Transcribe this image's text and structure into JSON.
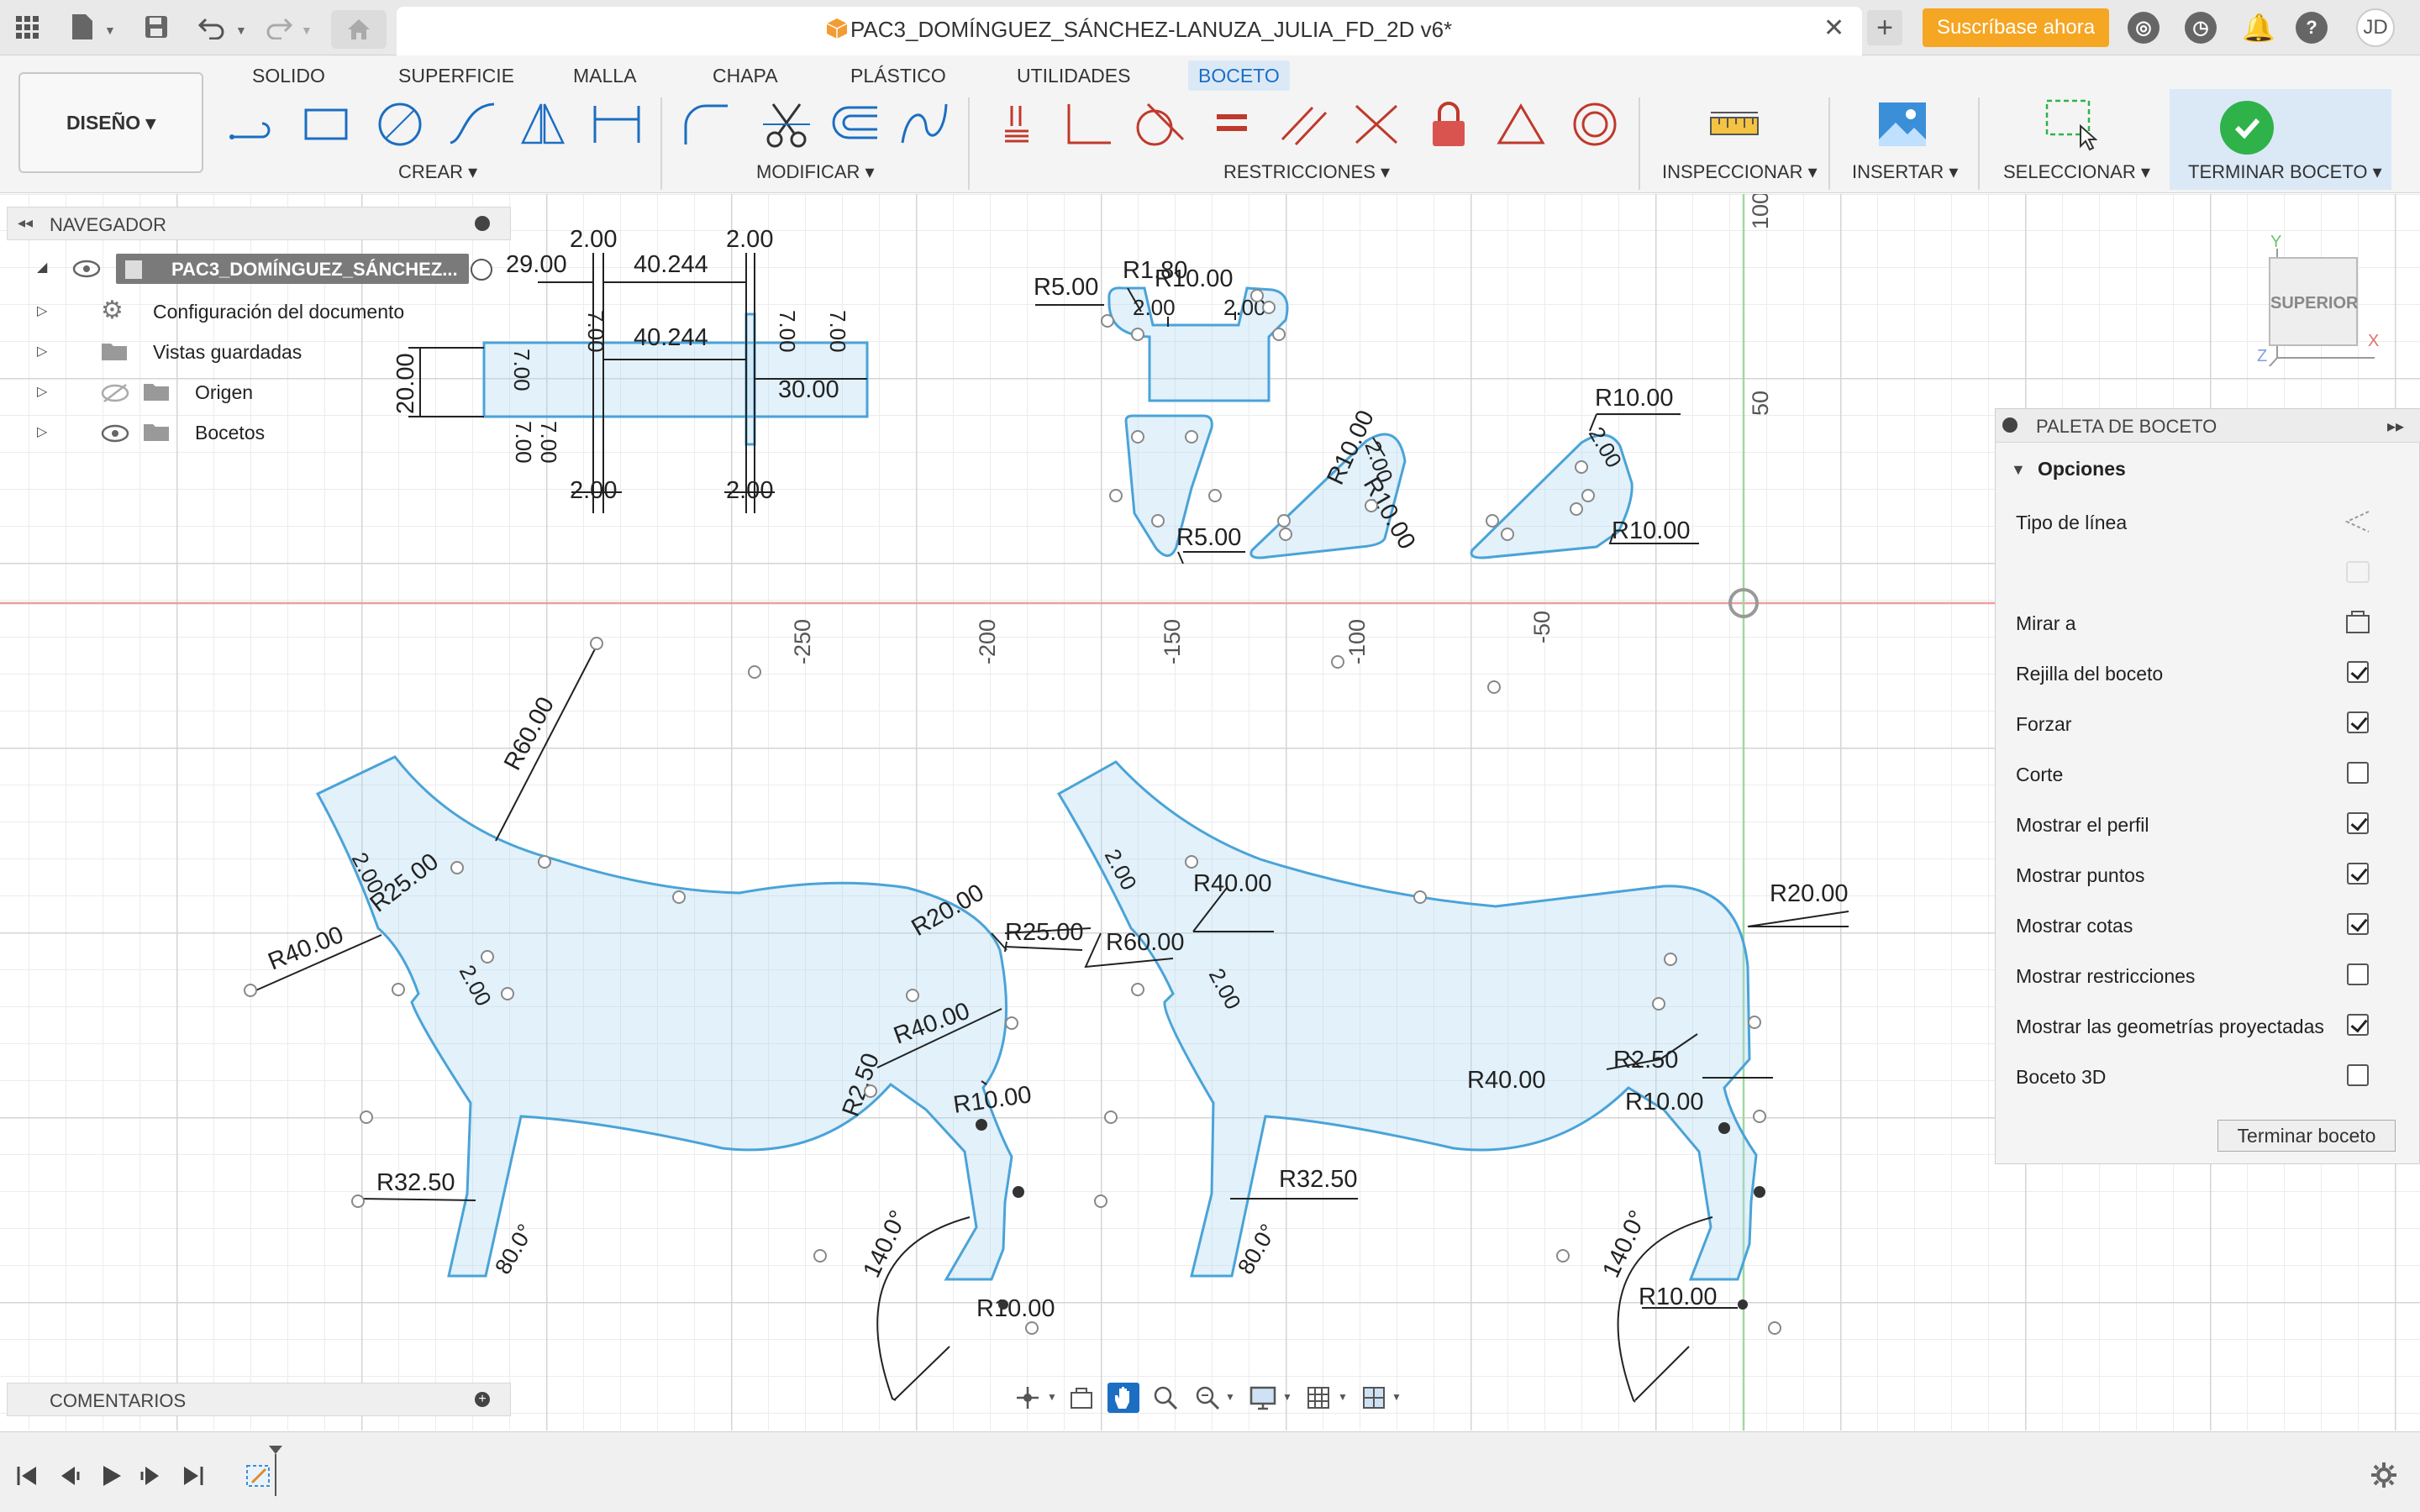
{
  "window": {
    "document_title": "PAC3_DOMÍNGUEZ_SÁNCHEZ-LANUZA_JULIA_FD_2D v6*",
    "subscribe_label": "Suscríbase ahora",
    "user_initials": "JD"
  },
  "ribbon": {
    "tabs": [
      "SOLIDO",
      "SUPERFICIE",
      "MALLA",
      "CHAPA",
      "PLÁSTICO",
      "UTILIDADES",
      "BOCETO"
    ],
    "active_tab": "BOCETO",
    "workspace_label": "DISEÑO ▾",
    "groups": {
      "crear": "CREAR ▾",
      "modificar": "MODIFICAR ▾",
      "restricciones": "RESTRICCIONES ▾",
      "inspeccionar": "INSPECCIONAR ▾",
      "insertar": "INSERTAR ▾",
      "seleccionar": "SELECCIONAR ▾",
      "terminar": "TERMINAR BOCETO ▾"
    }
  },
  "navigator": {
    "title": "NAVEGADOR",
    "root": "PAC3_DOMÍNGUEZ_SÁNCHEZ...",
    "items": [
      {
        "label": "Configuración del documento",
        "icon": "gear-icon"
      },
      {
        "label": "Vistas guardadas",
        "icon": "folder-icon"
      },
      {
        "label": "Origen",
        "icon": "folder-icon"
      },
      {
        "label": "Bocetos",
        "icon": "folder-icon"
      }
    ]
  },
  "palette": {
    "title": "PALETA DE BOCETO",
    "section": "Opciones",
    "options": [
      {
        "label": "Tipo de línea",
        "control": "icon"
      },
      {
        "label": "",
        "control": "icon-disabled"
      },
      {
        "label": "Mirar a",
        "control": "icon"
      },
      {
        "label": "Rejilla del boceto",
        "control": "checkbox",
        "checked": true
      },
      {
        "label": "Forzar",
        "control": "checkbox",
        "checked": true
      },
      {
        "label": "Corte",
        "control": "checkbox",
        "checked": false
      },
      {
        "label": "Mostrar el perfil",
        "control": "checkbox",
        "checked": true
      },
      {
        "label": "Mostrar puntos",
        "control": "checkbox",
        "checked": true
      },
      {
        "label": "Mostrar cotas",
        "control": "checkbox",
        "checked": true
      },
      {
        "label": "Mostrar restricciones",
        "control": "checkbox",
        "checked": false
      },
      {
        "label": "Mostrar las geometrías proyectadas",
        "control": "checkbox",
        "checked": true
      },
      {
        "label": "Boceto 3D",
        "control": "checkbox",
        "checked": false
      }
    ],
    "finish_label": "Terminar boceto"
  },
  "viewcube": {
    "face": "SUPERIOR"
  },
  "comments": {
    "label": "COMENTARIOS"
  },
  "axis_ticks": {
    "horizontal": [
      "-250",
      "-200",
      "-150",
      "-100",
      "-50"
    ],
    "vertical": [
      "100",
      "50"
    ]
  },
  "dimensions": {
    "top_left": [
      "2.00",
      "2.00",
      "29.00",
      "40.244",
      "7.00",
      "7.00",
      "40.244",
      "7.00",
      "7.00",
      "20.00",
      "30.00",
      "7.00",
      "7.00",
      "2.00",
      "2.00"
    ],
    "small_parts": [
      "R5.00",
      "R1.80",
      "R10.00",
      "2.00",
      "2.00",
      "R5.00",
      "R10.00",
      "R10.00",
      "2.00",
      "R10.00",
      "2.00",
      "R10.00"
    ],
    "left_dog": [
      "R60.00",
      "2.00",
      "R25.00",
      "R40.00",
      "2.00",
      "R20.00",
      "R25.00",
      "R40.00",
      "R2.50",
      "R10.00",
      "R32.50",
      "80.0°",
      "140.0°",
      "R10.00"
    ],
    "right_dog": [
      "2.00",
      "R40.00",
      "R60.00",
      "2.00",
      "R20.00",
      "R40.00",
      "R2.50",
      "R10.00",
      "R32.50",
      "80.0°",
      "140.0°",
      "R10.00"
    ]
  }
}
